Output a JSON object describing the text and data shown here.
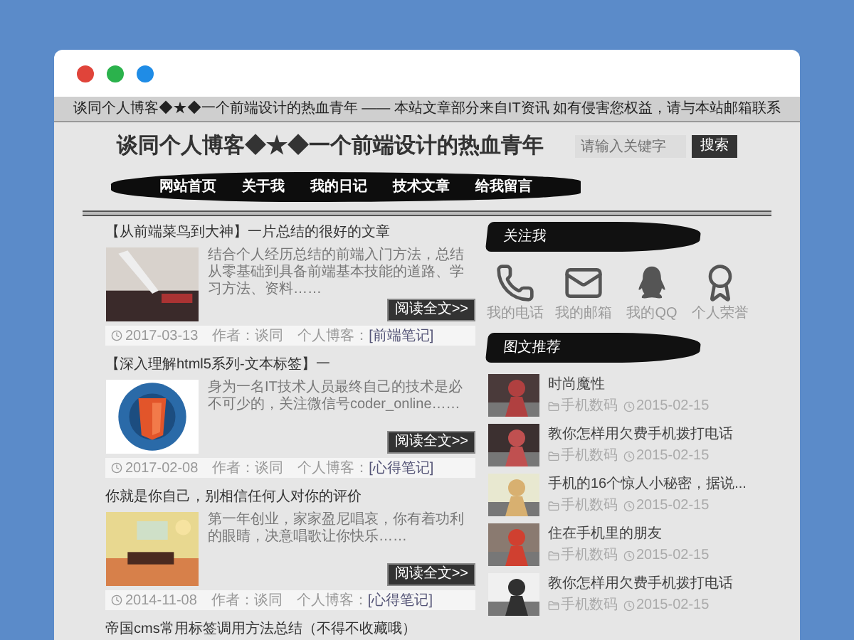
{
  "window_buttons": [
    {
      "color": "#e0443a"
    },
    {
      "color": "#2bb24c"
    },
    {
      "color": "#1f8ce6"
    }
  ],
  "top_banner": "谈同个人博客◆★◆一个前端设计的热血青年 —— 本站文章部分来自IT资讯 如有侵害您权益，请与本站邮箱联系",
  "site_title": "谈同个人博客◆★◆一个前端设计的热血青年",
  "search": {
    "placeholder": "请输入关键字",
    "button": "搜索"
  },
  "nav": [
    {
      "label": "网站首页"
    },
    {
      "label": "关于我"
    },
    {
      "label": "我的日记"
    },
    {
      "label": "技术文章"
    },
    {
      "label": "给我留言"
    }
  ],
  "articles": [
    {
      "title": "【从前端菜鸟到大神】一片总结的很好的文章",
      "excerpt": "结合个人经历总结的前端入门方法，总结从零基础到具备前端基本技能的道路、学习方法、资料……",
      "button": "阅读全文>>",
      "date": "2017-03-13",
      "author": "作者：谈同",
      "blog_label": "个人博客：",
      "category": "[前端笔记]"
    },
    {
      "title": "【深入理解html5系列-文本标签】一",
      "excerpt": "身为一名IT技术人员最终自己的技术是必不可少的，关注微信号coder_online……",
      "button": "阅读全文>>",
      "date": "2017-02-08",
      "author": "作者：谈同",
      "blog_label": "个人博客：",
      "category": "[心得笔记]"
    },
    {
      "title": "你就是你自己，别相信任何人对你的评价",
      "excerpt": "第一年创业，家家盈尼唱哀，你有着功利的眼睛，决意唱歌让你快乐……",
      "button": "阅读全文>>",
      "date": "2014-11-08",
      "author": "作者：谈同",
      "blog_label": "个人博客：",
      "category": "[心得笔记]"
    },
    {
      "title": "帝国cms常用标签调用方法总结（不得不收藏哦）"
    }
  ],
  "sidebar": {
    "follow": {
      "heading": "关注我",
      "items": [
        {
          "kind": "phone",
          "label": "我的电话"
        },
        {
          "kind": "mail",
          "label": "我的邮箱"
        },
        {
          "kind": "penguin",
          "label": "我的QQ"
        },
        {
          "kind": "award",
          "label": "个人荣誉"
        }
      ]
    },
    "recommend": {
      "heading": "图文推荐",
      "items": [
        {
          "title": "时尚魔性",
          "category": "手机数码",
          "date": "2015-02-15"
        },
        {
          "title": "教你怎样用欠费手机拨打电话",
          "category": "手机数码",
          "date": "2015-02-15"
        },
        {
          "title": "手机的16个惊人小秘密，据说...",
          "category": "手机数码",
          "date": "2015-02-15"
        },
        {
          "title": "住在手机里的朋友",
          "category": "手机数码",
          "date": "2015-02-15"
        },
        {
          "title": "教你怎样用欠费手机拨打电话",
          "category": "手机数码",
          "date": "2015-02-15"
        }
      ]
    }
  }
}
